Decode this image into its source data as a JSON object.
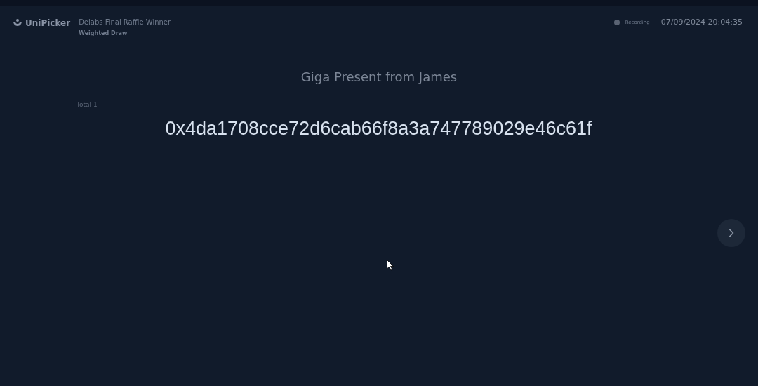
{
  "header": {
    "brand": "UniPicker",
    "title": "Delabs Final Raffle Winner",
    "subtitle": "Weighted Draw",
    "recording_label": "Recording",
    "datetime": "07/09/2024 20:04:35"
  },
  "prize": {
    "title": "Giga Present from James",
    "total": "Total 1"
  },
  "winners": [
    "0x4da1708cce72d6cab66f8a3a747789029e46c61f"
  ]
}
